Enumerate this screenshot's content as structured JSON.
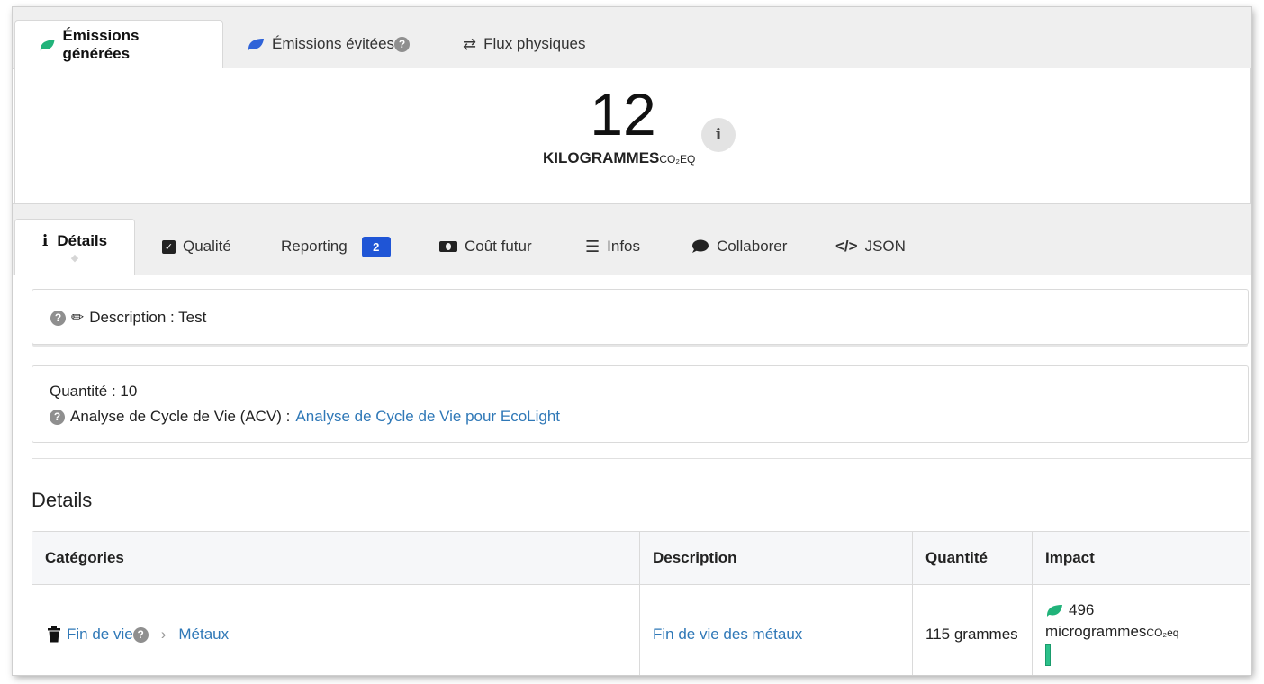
{
  "top_tabs": [
    {
      "label": "Émissions générées",
      "icon": "leaf-icon",
      "color": "#21b37a",
      "active": true
    },
    {
      "label": "Émissions évitées",
      "icon": "leaf-icon",
      "color": "#2f63d8",
      "active": false
    },
    {
      "label": "Flux physiques",
      "icon": "swap-arrows-icon",
      "active": false
    }
  ],
  "total": {
    "value": "12",
    "unit": "KILOGRAMMES",
    "unit_suffix": "CO₂EQ",
    "info_icon": "info-icon"
  },
  "detail_tabs": [
    {
      "label": "Détails",
      "icon": "info-icon",
      "active": true
    },
    {
      "label": "Qualité",
      "icon": "checkbox-icon"
    },
    {
      "label": "Reporting",
      "badge": "2",
      "badge_color": "#1f55d6"
    },
    {
      "label": "Coût futur",
      "icon": "money-bill-icon"
    },
    {
      "label": "Infos",
      "icon": "list-icon"
    },
    {
      "label": "Collaborer",
      "icon": "comment-icon"
    },
    {
      "label": "JSON",
      "icon": "code-icon"
    }
  ],
  "description": {
    "label": "Description : Test"
  },
  "quantity": {
    "label": "Quantité : 10",
    "acv_label": "Analyse de Cycle de Vie (ACV) :",
    "acv_link": "Analyse de Cycle de Vie pour EcoLight"
  },
  "details": {
    "title": "Details",
    "columns": [
      "Catégories",
      "Description",
      "Quantité",
      "Impact"
    ],
    "rows": [
      {
        "category": "Fin de vie",
        "subcategory": "Métaux",
        "description": "Fin de vie des métaux",
        "quantity": "115 grammes",
        "impact_value": "496",
        "impact_unit": "microgrammes",
        "impact_suffix": "CO₂eq",
        "impact_color": "#21b37a"
      }
    ]
  }
}
